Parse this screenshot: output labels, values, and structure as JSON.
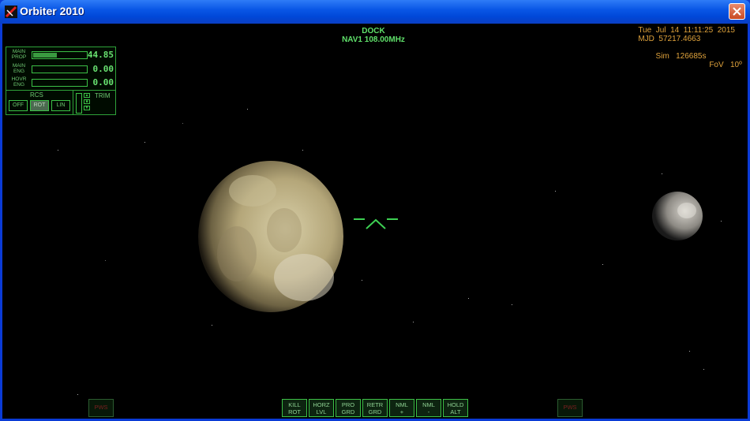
{
  "window": {
    "title": "Orbiter 2010"
  },
  "hud": {
    "mode": "DOCK",
    "nav": "NAV1  108.00MHz"
  },
  "info": {
    "date": "Tue  Jul  14  11:11:25  2015",
    "mjd": "MJD  57217.4663",
    "sim": "Sim   126685s",
    "fov": "FoV   10º"
  },
  "engines": [
    {
      "label": "MAIN PROP",
      "value": "44.85",
      "level": 0.45
    },
    {
      "label": "MAIN ENG",
      "value": "0.00",
      "level": 0
    },
    {
      "label": "HOVR ENG",
      "value": "0.00",
      "level": 0
    }
  ],
  "rcs": {
    "label": "RCS",
    "buttons": [
      "OFF",
      "ROT",
      "LIN"
    ],
    "active": "ROT"
  },
  "trim": {
    "label": "TRIM"
  },
  "autopilot": [
    {
      "line1": "KILL",
      "line2": "ROT"
    },
    {
      "line1": "HORZ",
      "line2": "LVL"
    },
    {
      "line1": "PRO",
      "line2": "GRD"
    },
    {
      "line1": "RETR",
      "line2": "GRD"
    },
    {
      "line1": "NML",
      "line2": "+"
    },
    {
      "line1": "NML",
      "line2": "-"
    },
    {
      "line1": "HOLD",
      "line2": "ALT"
    }
  ],
  "pws_left": "PWS",
  "pws_right": "PWS",
  "colors": {
    "hud_green": "#5fe06a",
    "info_orange": "#e0a33c",
    "titlebar": "#0a57e6"
  }
}
